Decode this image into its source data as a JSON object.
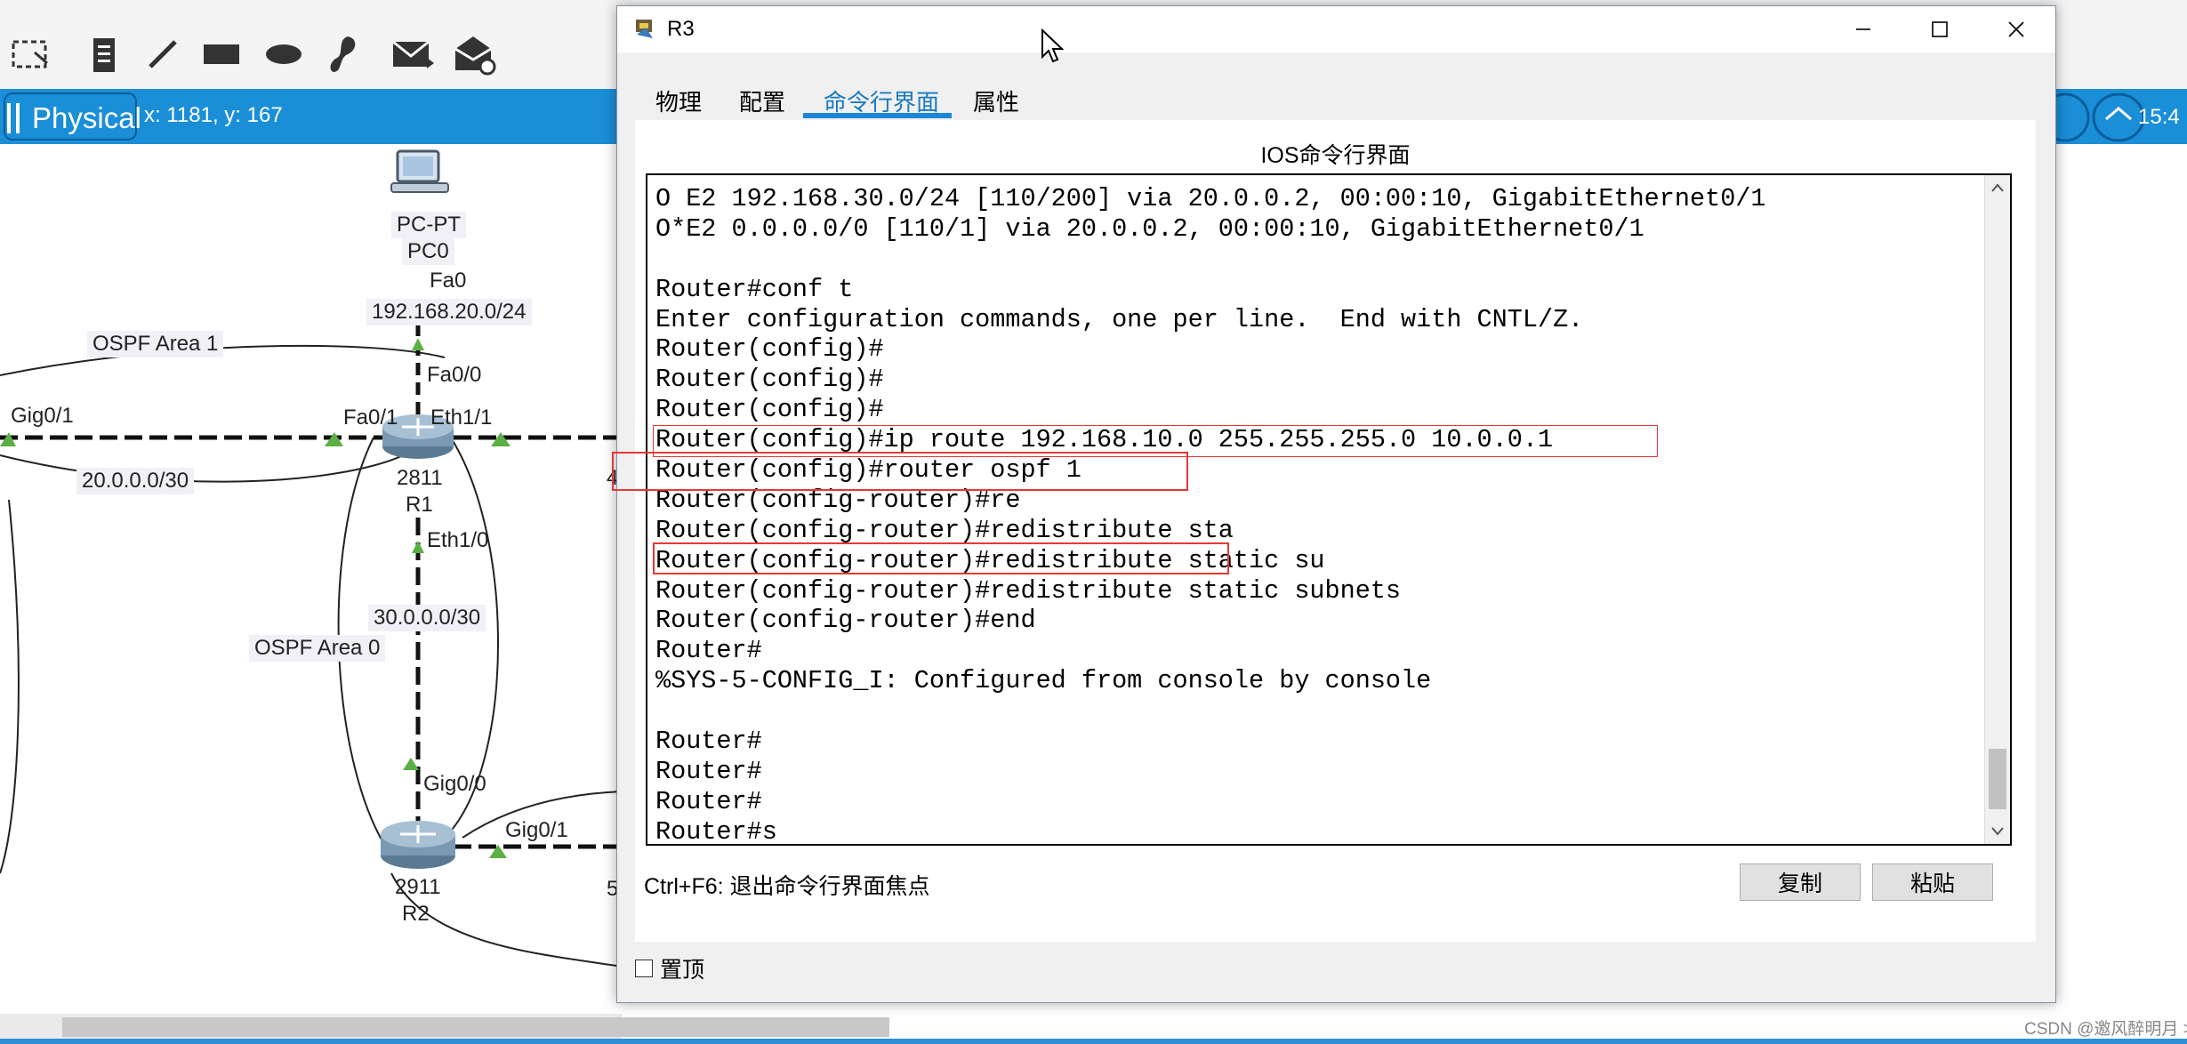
{
  "background_app": {
    "mode_label": "Physical",
    "coords": "x: 1181, y: 167",
    "clock": "15:4",
    "topology_labels": {
      "pc_type": "PC-PT",
      "pc_name": "PC0",
      "pc_iface": "Fa0",
      "lan_network": "192.168.20.0/24",
      "r1_fa00": "Fa0/0",
      "ospf_area1": "OSPF Area 1",
      "gig01_left": "Gig0/1",
      "r1_fa01": "Fa0/1",
      "r1_eth11": "Eth1/1",
      "link_20": "20.0.0.0/30",
      "r1_model": "2811",
      "r1_name": "R1",
      "partial_4": "4",
      "r1_eth10": "Eth1/0",
      "link_30": "30.0.0.0/30",
      "ospf_area0": "OSPF Area 0",
      "r2_gig00": "Gig0/0",
      "r2_gig01": "Gig0/1",
      "r2_model": "2911",
      "r2_name": "R2",
      "partial_5": "5"
    }
  },
  "window": {
    "title": "R3",
    "tabs": [
      {
        "label": "物理"
      },
      {
        "label": "配置"
      },
      {
        "label": "命令行界面"
      },
      {
        "label": "属性"
      }
    ],
    "ios_title": "IOS命令行界面",
    "terminal_lines": [
      "O E2 192.168.30.0/24 [110/200] via 20.0.0.2, 00:00:10, GigabitEthernet0/1",
      "O*E2 0.0.0.0/0 [110/1] via 20.0.0.2, 00:00:10, GigabitEthernet0/1",
      "",
      "Router#conf t",
      "Enter configuration commands, one per line.  End with CNTL/Z.",
      "Router(config)#",
      "Router(config)#",
      "Router(config)#",
      "Router(config)#ip route 192.168.10.0 255.255.255.0 10.0.0.1",
      "Router(config)#router ospf 1",
      "Router(config-router)#re",
      "Router(config-router)#redistribute sta",
      "Router(config-router)#redistribute static su",
      "Router(config-router)#redistribute static subnets",
      "Router(config-router)#end",
      "Router#",
      "%SYS-5-CONFIG_I: Configured from console by console",
      "",
      "Router#",
      "Router#",
      "Router#",
      "Router#s"
    ],
    "hint": "Ctrl+F6: 退出命令行界面焦点",
    "copy_label": "复制",
    "paste_label": "粘贴",
    "pin_label": "置顶"
  },
  "colors": {
    "accent_blue": "#1b8ed8",
    "active_tab": "#1979c2",
    "highlight_red": "#e53935"
  },
  "watermark": "CSDN @邀风醉明月 >"
}
